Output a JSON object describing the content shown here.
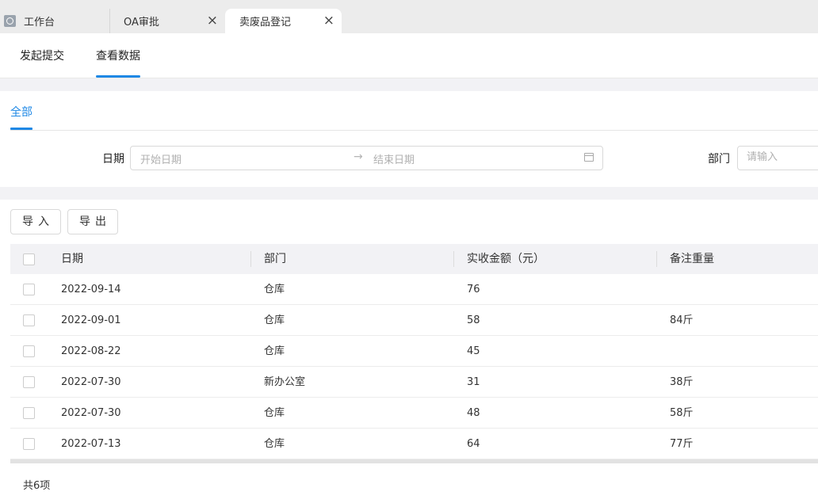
{
  "tabs": [
    {
      "label": "工作台",
      "closable": false,
      "active": false
    },
    {
      "label": "OA审批",
      "closable": true,
      "active": false
    },
    {
      "label": "卖废品登记",
      "closable": true,
      "active": true
    }
  ],
  "subtabs": [
    {
      "label": "发起提交",
      "active": false
    },
    {
      "label": "查看数据",
      "active": true
    }
  ],
  "filter_scope": "全部",
  "filters": {
    "date_label": "日期",
    "start_placeholder": "开始日期",
    "end_placeholder": "结束日期",
    "dept_label": "部门",
    "dept_placeholder": "请输入"
  },
  "actions": {
    "import": "导入",
    "export": "导出"
  },
  "table": {
    "columns": [
      "日期",
      "部门",
      "实收金额（元）",
      "备注重量"
    ],
    "rows": [
      {
        "date": "2022-09-14",
        "dept": "仓库",
        "amount": "76",
        "weight": ""
      },
      {
        "date": "2022-09-01",
        "dept": "仓库",
        "amount": "58",
        "weight": "84斤"
      },
      {
        "date": "2022-08-22",
        "dept": "仓库",
        "amount": "45",
        "weight": ""
      },
      {
        "date": "2022-07-30",
        "dept": "新办公室",
        "amount": "31",
        "weight": "38斤"
      },
      {
        "date": "2022-07-30",
        "dept": "仓库",
        "amount": "48",
        "weight": "58斤"
      },
      {
        "date": "2022-07-13",
        "dept": "仓库",
        "amount": "64",
        "weight": "77斤"
      }
    ]
  },
  "total": "共6项",
  "colors": {
    "accent": "#1e88e5",
    "band": "#f2f2f5"
  }
}
